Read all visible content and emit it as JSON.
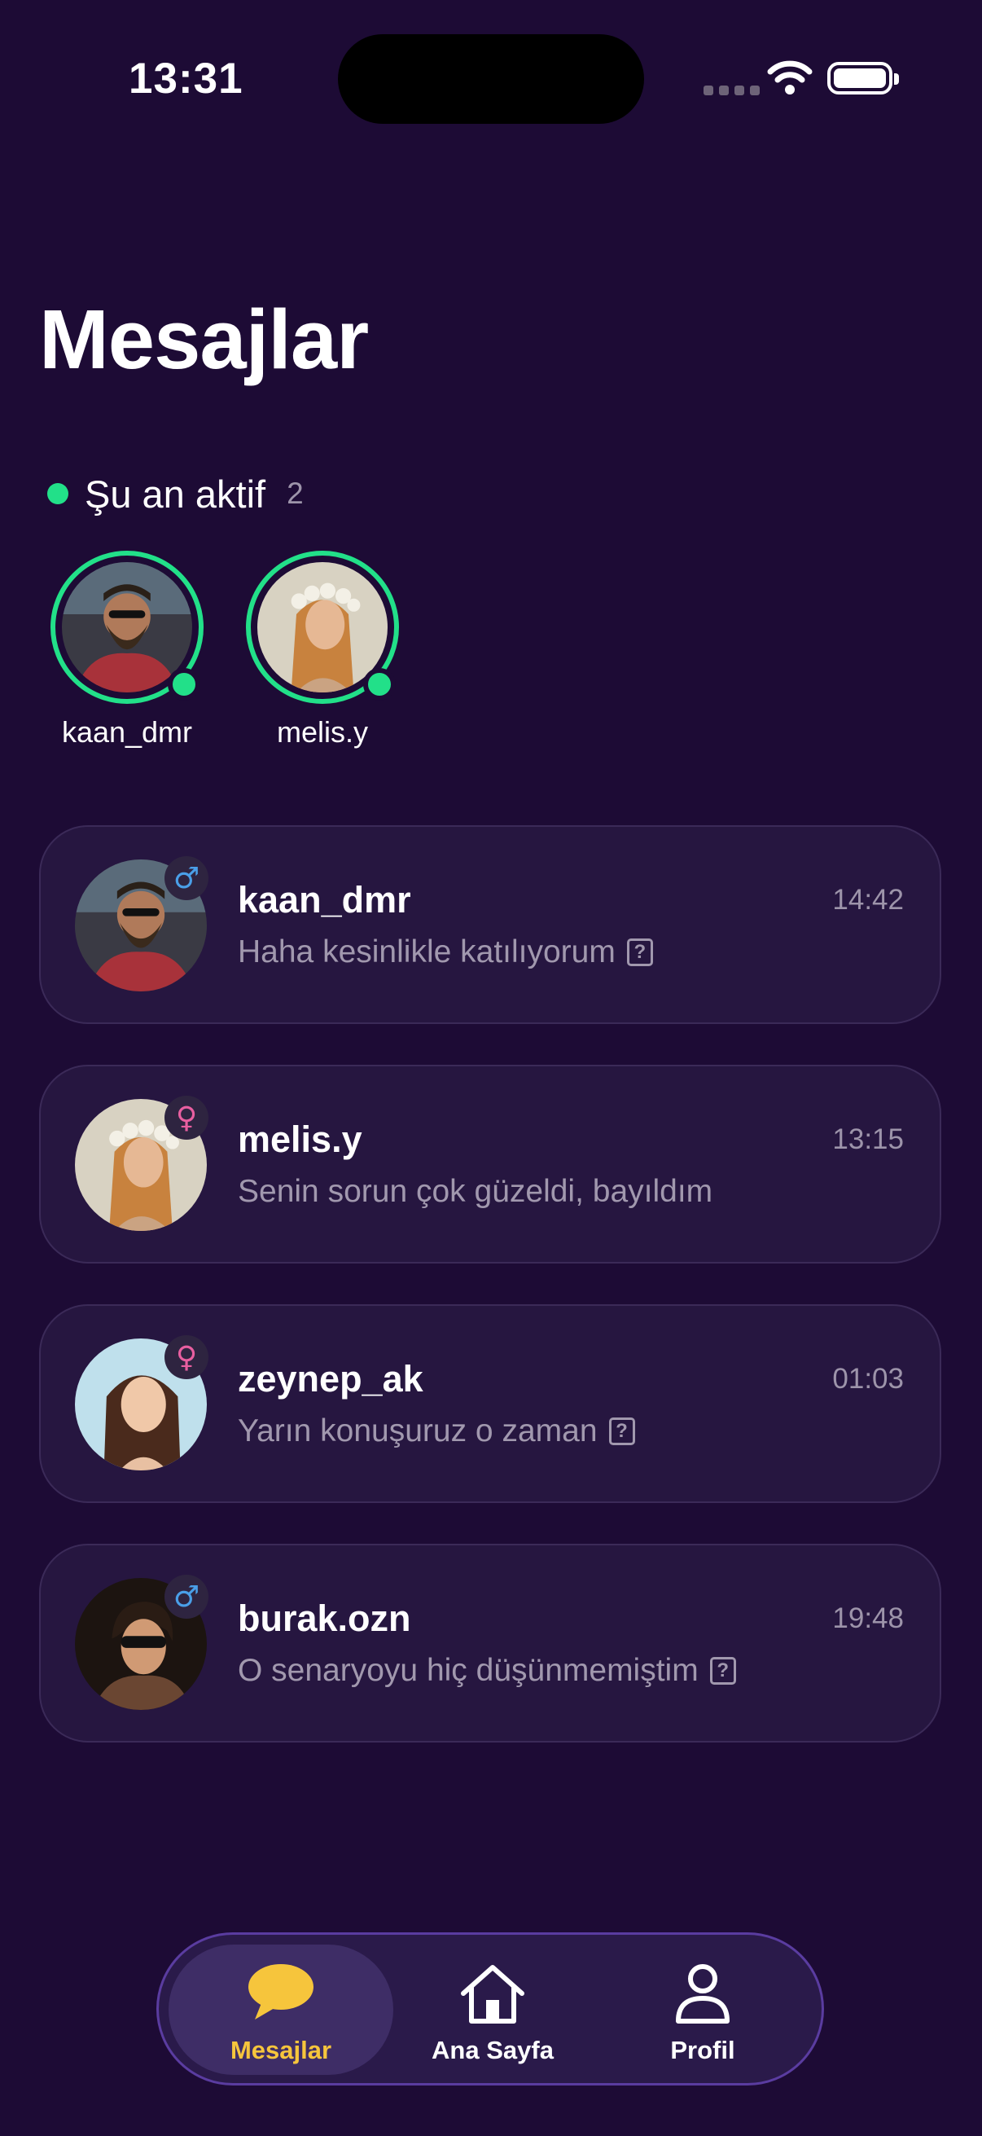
{
  "status_bar": {
    "time": "13:31"
  },
  "page": {
    "title": "Mesajlar"
  },
  "active_now": {
    "label": "Şu an aktif",
    "count": "2",
    "users": [
      {
        "name": "kaan_dmr",
        "avatar": "avatar-kaan"
      },
      {
        "name": "melis.y",
        "avatar": "avatar-melis"
      }
    ]
  },
  "chats": [
    {
      "name": "kaan_dmr",
      "time": "14:42",
      "message": "Haha kesinlikle katılıyorum",
      "gender": "male",
      "gender_symbol": "♂",
      "badge": "?"
    },
    {
      "name": "melis.y",
      "time": "13:15",
      "message": "Senin sorun çok güzeldi, bayıldım",
      "gender": "female",
      "gender_symbol": "♀",
      "badge": ""
    },
    {
      "name": "zeynep_ak",
      "time": "01:03",
      "message": "Yarın konuşuruz o zaman",
      "gender": "female",
      "gender_symbol": "♀",
      "badge": "?"
    },
    {
      "name": "burak.ozn",
      "time": "19:48",
      "message": "O senaryoyu hiç düşünmemiştim",
      "gender": "male",
      "gender_symbol": "♂",
      "badge": "?"
    }
  ],
  "tabbar": {
    "tabs": [
      {
        "label": "Mesajlar",
        "icon": "chat-bubble-icon",
        "active": true
      },
      {
        "label": "Ana Sayfa",
        "icon": "home-icon",
        "active": false
      },
      {
        "label": "Profil",
        "icon": "profile-icon",
        "active": false
      }
    ]
  },
  "colors": {
    "background": "#1d0b35",
    "online": "#22e089",
    "active_tab": "#f6c53c",
    "male": "#4a9fe8",
    "female": "#e85fa0"
  }
}
